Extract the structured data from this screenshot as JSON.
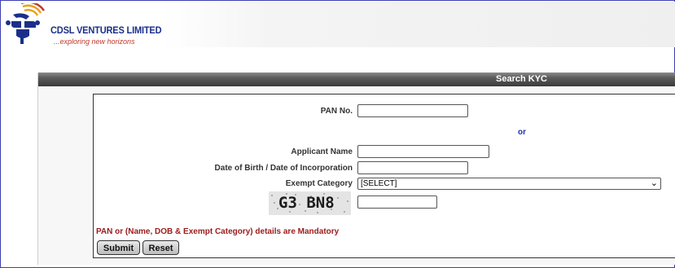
{
  "brand": {
    "name": "CDSL VENTURES LIMITED",
    "tagline": "...exploring new horizons",
    "logo_icon": "cdsl-logo-icon",
    "colors": {
      "primary": "#1a2f8a",
      "accent": "#c0392b",
      "secondary": "#e8a31a"
    }
  },
  "title_bar": {
    "title": "Search KYC"
  },
  "form": {
    "pan_label": "PAN No.",
    "pan_value": "",
    "or_text": "or",
    "applicant_name_label": "Applicant Name",
    "applicant_name_value": "",
    "dob_label": "Date of Birth / Date of Incorporation",
    "dob_value": "",
    "exempt_label": "Exempt Category",
    "exempt_selected": "[SELECT]",
    "captcha_text": "G3 BN8",
    "captcha_value": "",
    "mandatory_note": "PAN or (Name, DOB & Exempt Category) details are Mandatory",
    "submit_label": "Submit",
    "reset_label": "Reset"
  },
  "colors": {
    "title_bar": "#4a4a4a",
    "mandatory_text": "#9b1b1b",
    "or_text": "#1a33a8"
  }
}
